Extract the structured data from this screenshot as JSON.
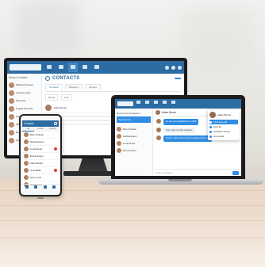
{
  "desktop": {
    "nav_items": [
      "",
      "",
      "",
      "",
      ""
    ],
    "sidebar_title": "Recent Contacts",
    "contacts": [
      "Matthew Powers",
      "Joanna Lewis",
      "Paul Hart",
      "Angela Newman",
      "Daniel Walsh",
      "Olivia Brooks",
      "Ryan Carter",
      "Sophie Ward"
    ],
    "page_title": "CONTACTS",
    "primary_button": "",
    "tabs": [
      "Contacts",
      "Directory",
      "Groups"
    ],
    "filters": [
      "Name",
      "Sort"
    ],
    "card_name": "Katie Moore"
  },
  "laptop": {
    "sidebar_header": "Recent Conversations",
    "selected_conversation": "Team Room",
    "contacts": [
      "Brian Sullivan",
      "Rachel Evans",
      "Lucas Reed",
      "Emma Foster"
    ],
    "chat_name": "Adam Brown",
    "messages": [
      {
        "text": "Hi, are you available for a call?",
        "style": "blue"
      },
      {
        "text": "Sure, give me five minutes.",
        "style": "gray"
      },
      {
        "text": "Great, I will send you the meeting invite now.",
        "style": "blue"
      }
    ],
    "input_placeholder": "Type a message...",
    "popup": {
      "name": "Adam Brown",
      "actions": [
        "Start video call",
        "Send file",
        "Schedule meeting",
        "View profile"
      ],
      "active_index": 0
    }
  },
  "phone": {
    "title": "Contacts",
    "tabs": [
      "All",
      "Online",
      "Groups"
    ],
    "active_tab": 0,
    "contacts": [
      "Brian Sullivan",
      "Rachel Evans",
      "Lucas Reed",
      "Emma Foster",
      "Adam Brown",
      "Nora Blake",
      "Henry Cole",
      "Grace Long"
    ]
  },
  "colors": {
    "brand_blue": "#2d6ca3",
    "accent_blue": "#2f8de4",
    "badge_red": "#e53935"
  }
}
